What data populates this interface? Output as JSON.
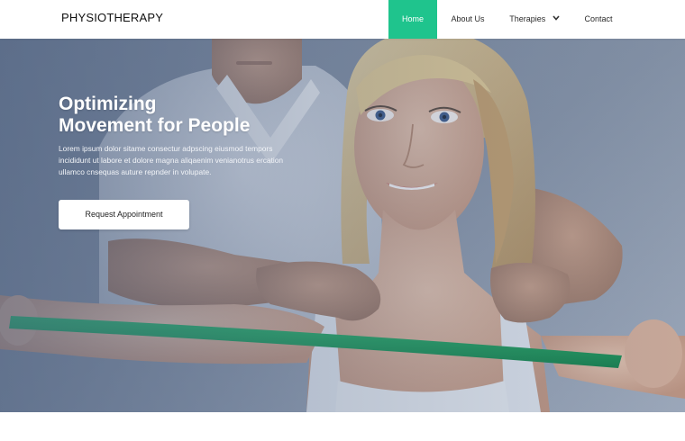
{
  "brand": {
    "logo_text": "PHYSIOTHERAPY"
  },
  "nav": {
    "items": [
      {
        "label": "Home",
        "active": true
      },
      {
        "label": "About Us"
      },
      {
        "label": "Therapies",
        "has_dropdown": true
      },
      {
        "label": "Contact"
      }
    ],
    "active_color": "#1fc48d"
  },
  "hero": {
    "title_line1": "Optimizing",
    "title_line2": "Movement for People",
    "body_line1": "Lorem ipsum dolor sitame consectur adpscing eiusmod tempors",
    "body_line2": "incididunt ut labore et dolore magna aliqaenim venianotrus ercation",
    "body_line3": "ullamco cnsequas auture repnder in volupate.",
    "cta_label": "Request Appointment",
    "image": "physiotherapist-with-patient-photo"
  }
}
